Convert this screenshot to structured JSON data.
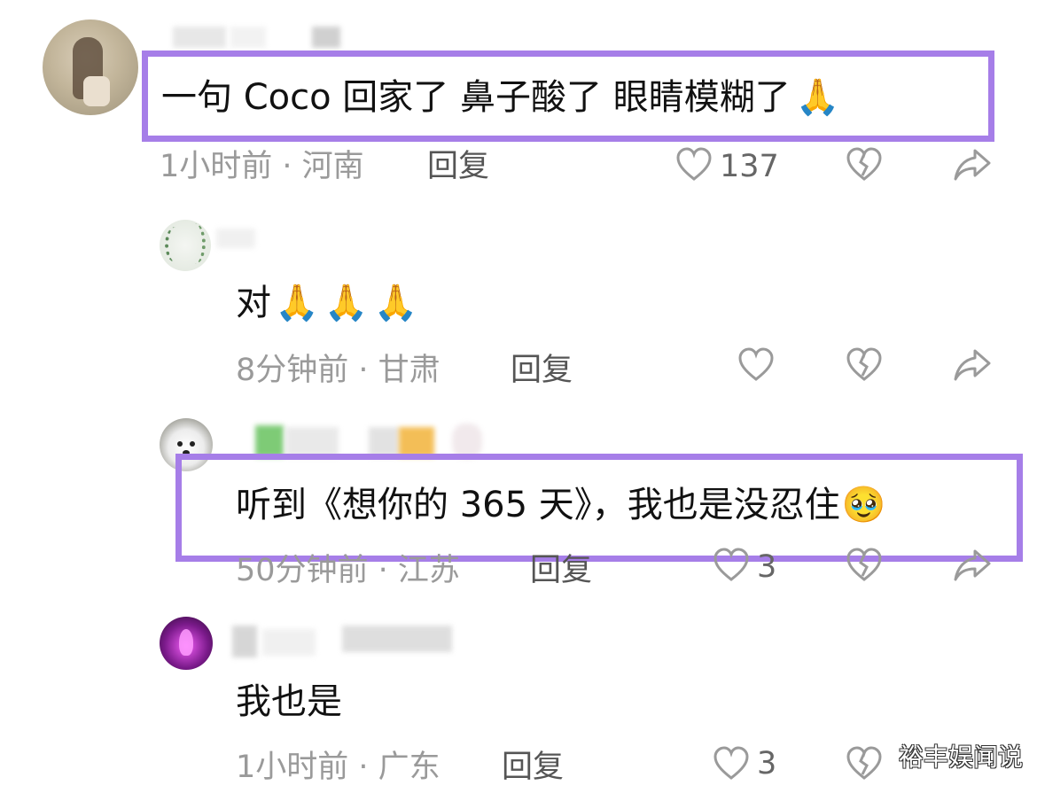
{
  "comments": [
    {
      "text": "一句 Coco 回家了 鼻子酸了 眼睛模糊了",
      "emoji": "🙏",
      "meta": "1小时前 · 河南",
      "reply_label": "回复",
      "likes": "137"
    },
    {
      "text": "对",
      "emoji": "🙏🙏🙏",
      "meta": "8分钟前 · 甘肃",
      "reply_label": "回复",
      "likes": ""
    },
    {
      "text": "听到《想你的 365 天》，我也是没忍住",
      "emoji": "🥹",
      "meta": "50分钟前 · 江苏",
      "reply_label": "回复",
      "likes": "3"
    },
    {
      "text": "我也是",
      "emoji": "",
      "meta": "1小时前 · 广东",
      "reply_label": "回复",
      "likes": "3"
    }
  ],
  "icons": {
    "like": "heart-outline-icon",
    "dislike": "broken-heart-icon",
    "share": "share-arrow-icon"
  },
  "colors": {
    "highlight": "#a67ee8",
    "meta_text": "#9a9a9a",
    "icon_stroke": "#9a9a9a"
  },
  "watermark": "裕丰娱闻说"
}
